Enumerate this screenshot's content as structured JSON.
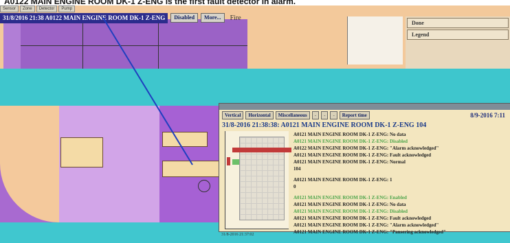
{
  "caption": "A0122 MAIN ENGINE ROOM DK-1 Z-ENG is the first fault detector in alarm.",
  "top_tabs": [
    "Sensor",
    "Zone",
    "Detector",
    "Pump"
  ],
  "alarm_bar": {
    "text": "31/8/2016 21:38 A0122 MAIN ENGINE ROOM DK-1 Z-ENG",
    "disabled_label": "Disabled",
    "more_label": "More...",
    "fire_label": "Fire"
  },
  "right_panel": {
    "items": [
      "Done",
      "Legend"
    ]
  },
  "popup": {
    "toolbar": {
      "vertical": "Vertical",
      "horizontal": "Horizontal",
      "miscellaneous": "Miscellaneous",
      "b1": "-",
      "b2": "-",
      "b3": "-",
      "report": "Report time"
    },
    "date": "8/9-2016 7:11",
    "header": "31/8-2016 21:38:38: A0121 MAIN ENGINE ROOM DK-1 Z-ENG 104",
    "graph_time": "31/8-2016 21:37:02",
    "events": [
      {
        "text": "A0121 MAIN ENGINE ROOM DK-1 Z-ENG: No data",
        "color": "dark"
      },
      {
        "text": "A0121 MAIN ENGINE ROOM DK-1 Z-ENG: Disabled",
        "color": "green"
      },
      {
        "text": "A0122 MAIN ENGINE ROOM DK-1 Z-ENG: \"Alarm acknowledged\"",
        "color": "dark"
      },
      {
        "text": "A0121 MAIN ENGINE ROOM DK-1 Z-ENG: Fault acknowledged",
        "color": "dark"
      },
      {
        "text": "A0121 MAIN ENGINE ROOM DK-1 Z-ENG: Normal",
        "color": "dark"
      },
      {
        "text": "104",
        "color": "dark"
      },
      {
        "text": "",
        "color": "gap"
      },
      {
        "text": "A0121 MAIN ENGINE ROOM DK-1 Z-ENG: 1",
        "color": "dark"
      },
      {
        "text": "0",
        "color": "dark"
      },
      {
        "text": "",
        "color": "gap"
      },
      {
        "text": "A0121 MAIN ENGINE ROOM DK-1 Z-ENG: Enabled",
        "color": "green"
      },
      {
        "text": "A0121 MAIN ENGINE ROOM DK-1 Z-ENG: No data",
        "color": "dark"
      },
      {
        "text": "A0121 MAIN ENGINE ROOM DK-1 Z-ENG: Disabled",
        "color": "green"
      },
      {
        "text": "A0121 MAIN ENGINE ROOM DK-1 Z-ENG: Fault acknowledged",
        "color": "dark"
      },
      {
        "text": "A0121 MAIN ENGINE ROOM DK-1 Z-ENG: \"Alarm acknowledged\"",
        "color": "dark"
      },
      {
        "text": "A0121 MAIN ENGINE ROOM DK-1 Z-ENG: \"Pansering acknowledged\"",
        "color": "dark"
      }
    ]
  },
  "colors": {
    "sea": "#40c7cf",
    "deck": "#f3c99b",
    "zone_purple": "#a86ad0",
    "alarm_red": "#c23a3a",
    "status_green": "#4ca44a"
  }
}
